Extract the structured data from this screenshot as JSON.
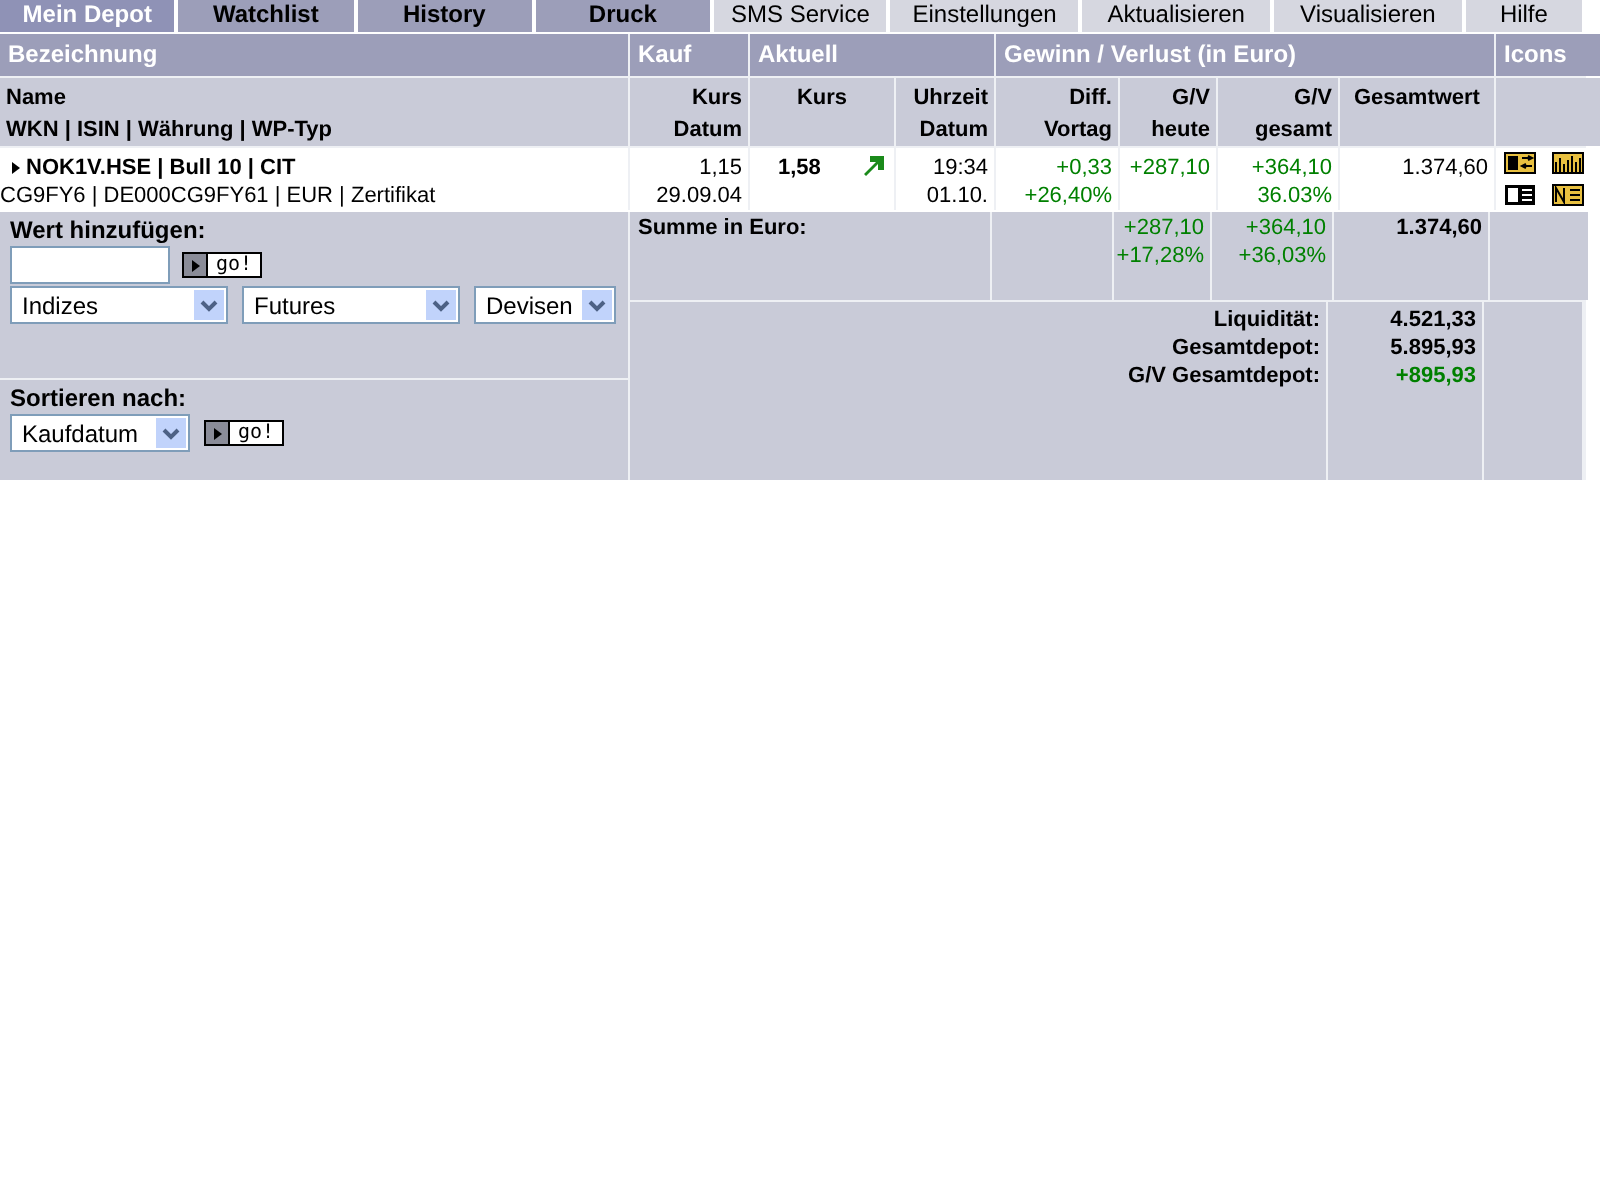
{
  "tabs": [
    {
      "label": "Mein Depot",
      "selected": true
    },
    {
      "label": "Watchlist",
      "selected": false
    },
    {
      "label": "History",
      "selected": false
    },
    {
      "label": "Druck",
      "selected": false
    }
  ],
  "menu": [
    "SMS Service",
    "Einstellungen",
    "Aktualisieren",
    "Visualisieren",
    "Hilfe"
  ],
  "table": {
    "groups": [
      "Bezeichnung",
      "Kauf",
      "Aktuell",
      "Gewinn / Verlust  (in Euro)",
      "Icons"
    ],
    "columns": [
      [
        "Name",
        "WKN | ISIN | Währung | WP-Typ"
      ],
      [
        "Kurs",
        "Datum"
      ],
      [
        "Kurs"
      ],
      [
        "Uhrzeit",
        "Datum"
      ],
      [
        "Diff.",
        "Vortag"
      ],
      [
        "G/V",
        "heute"
      ],
      [
        "G/V",
        "gesamt"
      ],
      [
        "Gesamtwert"
      ]
    ],
    "rows": [
      {
        "name": "NOK1V.HSE | Bull 10 | CIT",
        "details": "CG9FY6 | DE000CG9FY61 | EUR | Zertifikat",
        "kauf_kurs": "1,15",
        "kauf_datum": "29.09.04",
        "kurs": "1,58",
        "trend_up": true,
        "uhrzeit": "19:34",
        "datum": "01.10.",
        "diff": "+0,33",
        "diff_pct": "+26,40%",
        "gv_heute": "+287,10",
        "gv_gesamt": "+364,10",
        "gv_gesamt_pct": "36.03%",
        "gesamtwert": "1.374,60"
      }
    ]
  },
  "add_form": {
    "label": "Wert hinzufügen:",
    "button": "go!",
    "selects": [
      "Indizes",
      "Futures",
      "Devisen"
    ]
  },
  "sort_form": {
    "label": "Sortieren nach:",
    "select": "Kaufdatum",
    "button": "go!"
  },
  "summary": {
    "label": "Summe in Euro:",
    "gv_heute": "+287,10",
    "gv_heute_pct": "+17,28%",
    "gv_gesamt": "+364,10",
    "gv_gesamt_pct": "+36,03%",
    "gesamtwert": "1.374,60"
  },
  "totals": [
    {
      "label": "Liquidität:",
      "value": "4.521,33",
      "kind": "amount"
    },
    {
      "label": "Gesamtdepot:",
      "value": "5.895,93",
      "kind": "amount"
    },
    {
      "label": "G/V Gesamtdepot:",
      "value": "+895,93",
      "kind": "gain"
    }
  ]
}
